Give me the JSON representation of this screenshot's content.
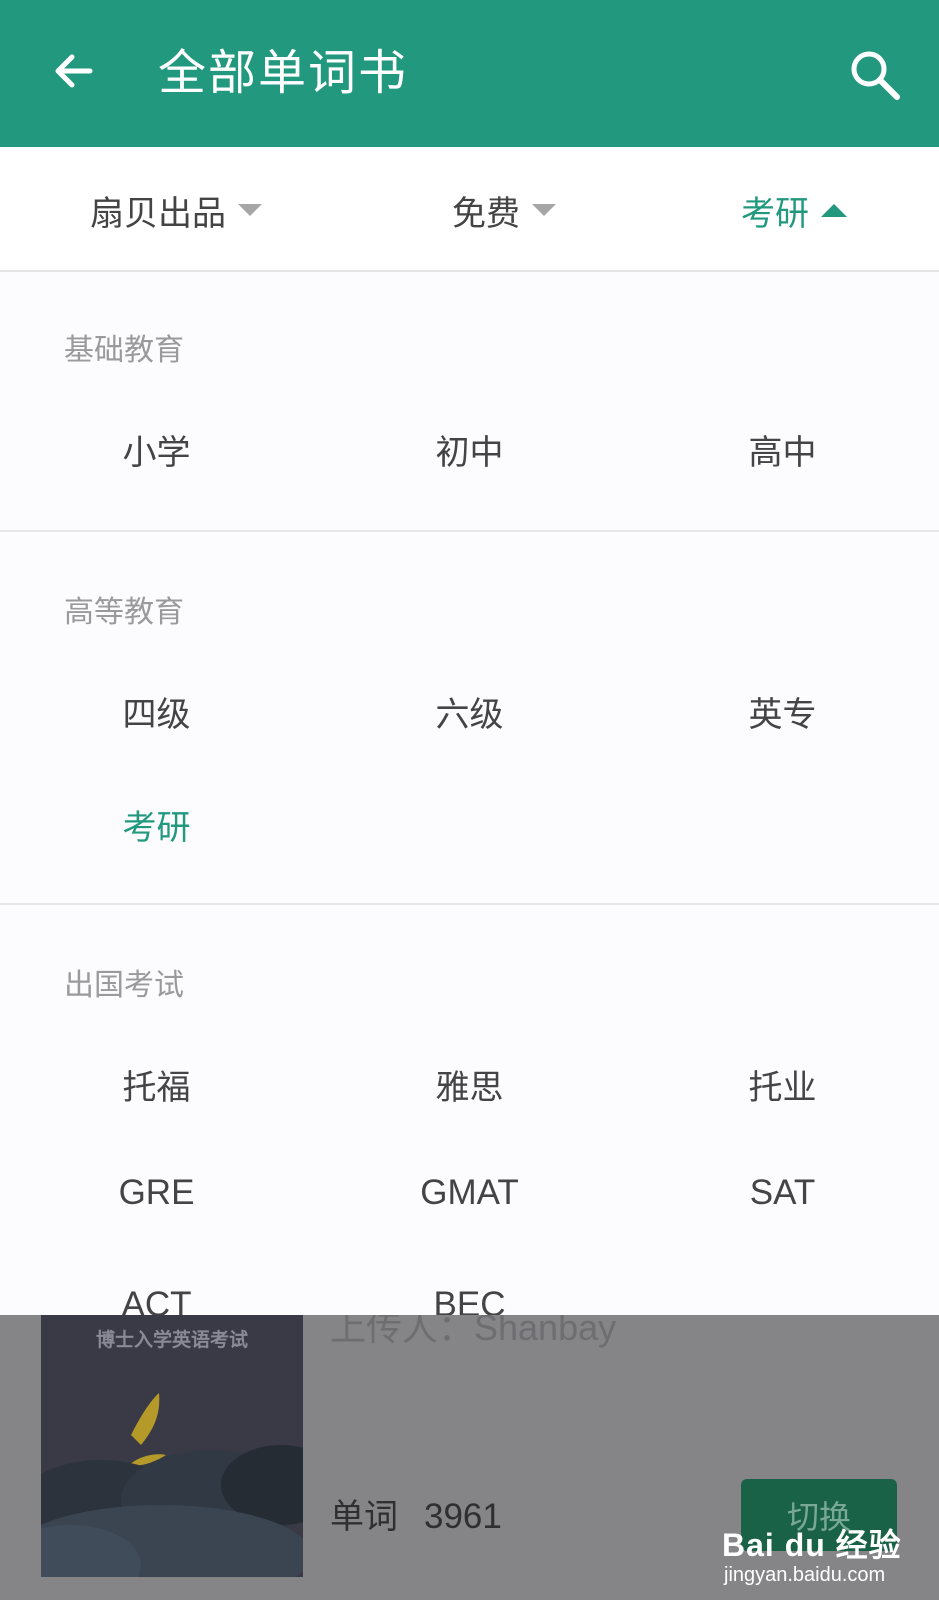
{
  "appbar": {
    "title": "全部单词书",
    "back_icon": "arrow-left-icon",
    "search_icon": "search-icon",
    "background": "#22997e"
  },
  "filters": [
    {
      "label": "扇贝出品",
      "state": "collapsed"
    },
    {
      "label": "免费",
      "state": "collapsed"
    },
    {
      "label": "考研",
      "state": "expanded"
    }
  ],
  "sections": {
    "basic": {
      "title": "基础教育",
      "items": [
        "小学",
        "初中",
        "高中"
      ]
    },
    "higher": {
      "title": "高等教育",
      "items": [
        "四级",
        "六级",
        "英专",
        "考研"
      ],
      "selected": "考研"
    },
    "abroad": {
      "title": "出国考试",
      "items": [
        "托福",
        "雅思",
        "托业",
        "GRE",
        "GMAT",
        "SAT",
        "ACT",
        "BEC"
      ]
    }
  },
  "background_book": {
    "cover_text": "博士入学英语考试",
    "uploader": "上传人：Shanbay",
    "word_label": "单词",
    "word_count": "3961",
    "button_label": "切换"
  },
  "watermark": {
    "logo": "Bai du 经验",
    "url": "jingyan.baidu.com"
  },
  "colors": {
    "accent": "#22997e",
    "text": "#444444",
    "muted": "#9a9a9a",
    "overlay": "#858487"
  }
}
